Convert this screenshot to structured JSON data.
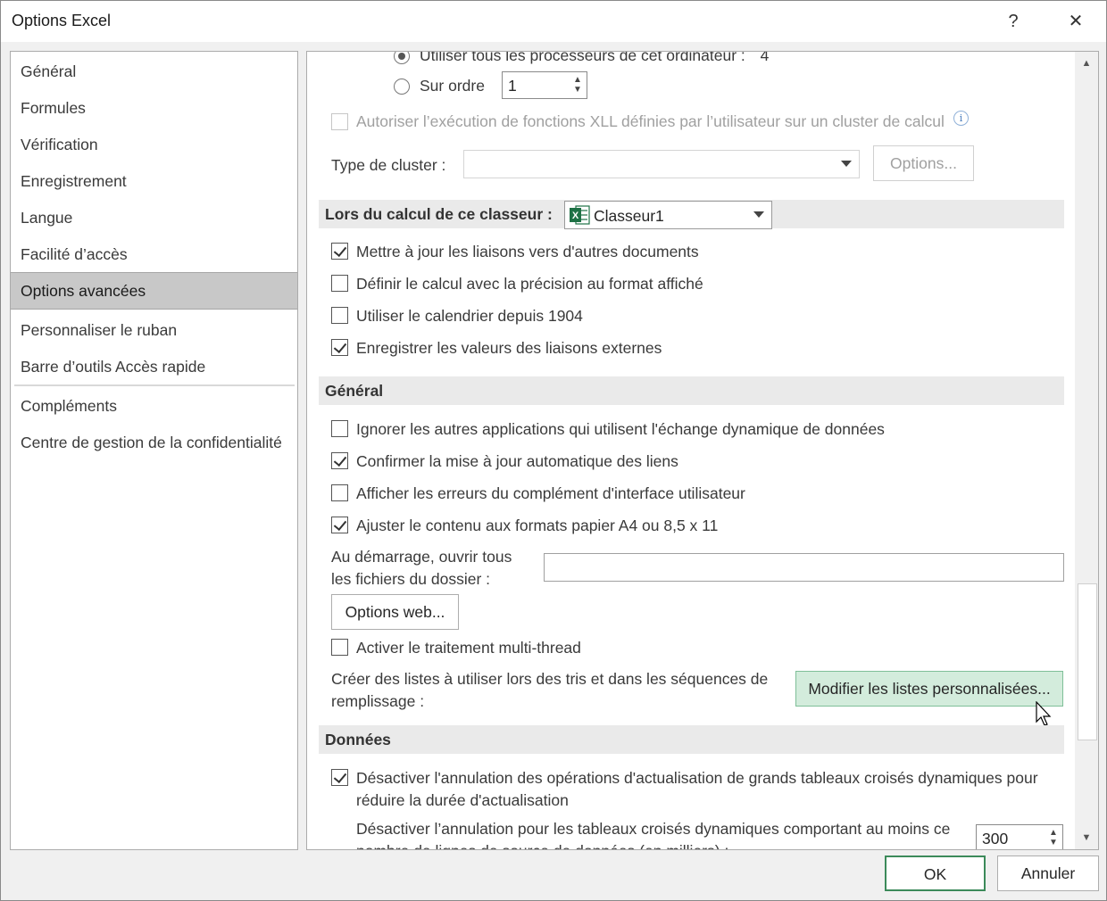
{
  "window": {
    "title": "Options Excel",
    "help_label": "?",
    "close_label": "✕"
  },
  "nav": {
    "items": [
      {
        "label": "Général"
      },
      {
        "label": "Formules"
      },
      {
        "label": "Vérification"
      },
      {
        "label": "Enregistrement"
      },
      {
        "label": "Langue"
      },
      {
        "label": "Facilité d’accès"
      },
      {
        "label": "Options avancées"
      },
      {
        "label": "Personnaliser le ruban"
      },
      {
        "label": "Barre d’outils Accès rapide"
      },
      {
        "label": "Compléments"
      },
      {
        "label": "Centre de gestion de la confidentialité"
      }
    ],
    "selected": "Options avancées"
  },
  "formulas": {
    "all_processors_label": "Utiliser tous les processeurs de cet ordinateur :",
    "all_processors_count": "4",
    "manual_label": "Sur ordre",
    "manual_value": "1",
    "xll_cluster_label": "Autoriser l’exécution de fonctions XLL définies par l’utilisateur sur un cluster de calcul",
    "info_icon": "i",
    "cluster_type_label": "Type de cluster :",
    "cluster_options_button": "Options..."
  },
  "workbook_calc": {
    "header": "Lors du calcul de ce classeur :",
    "workbook_select": "Classeur1",
    "options": [
      {
        "label": "Mettre à jour les liaisons vers d'autres documents",
        "checked": true
      },
      {
        "label": "Définir le calcul avec la précision au format affiché",
        "checked": false
      },
      {
        "label": "Utiliser le calendrier depuis 1904",
        "checked": false
      },
      {
        "label": "Enregistrer les valeurs des liaisons externes",
        "checked": true
      }
    ]
  },
  "general": {
    "header": "Général",
    "options": [
      {
        "label": "Ignorer les autres applications qui utilisent l'échange dynamique de données",
        "checked": false
      },
      {
        "label": "Confirmer la mise à jour automatique des liens",
        "checked": true
      },
      {
        "label": "Afficher les erreurs du complément d'interface utilisateur",
        "checked": false
      },
      {
        "label": "Ajuster le contenu aux formats papier A4 ou 8,5 x 11",
        "checked": true
      }
    ],
    "startup_label_line1": "Au démarrage, ouvrir tous",
    "startup_label_line2": "les fichiers du dossier :",
    "startup_value": "",
    "web_options_button": "Options web...",
    "multithread_label": "Activer le traitement multi-thread",
    "multithread_checked": false,
    "custom_lists_line1": "Créer des listes à utiliser lors des tris et dans les séquences de",
    "custom_lists_line2": "remplissage :",
    "custom_lists_button": "Modifier les listes personnalisées..."
  },
  "data": {
    "header": "Données",
    "pivot_undo_line1": "Désactiver l'annulation des opérations d'actualisation de grands tableaux croisés dynamiques pour",
    "pivot_undo_line2": "réduire la durée d'actualisation",
    "pivot_undo_checked": true,
    "pivot_min_rows_line1": "Désactiver l’annulation pour les tableaux croisés dynamiques comportant au moins ce",
    "pivot_min_rows_line2": "nombre de lignes de source de données (en milliers) :",
    "pivot_min_rows_value": "300"
  },
  "footer": {
    "ok_label": "OK",
    "cancel_label": "Annuler"
  },
  "colors": {
    "hover_button_bg": "#d3ecdc",
    "excel_green": "#1e7145",
    "selected_nav_bg": "#c8c8c8"
  }
}
